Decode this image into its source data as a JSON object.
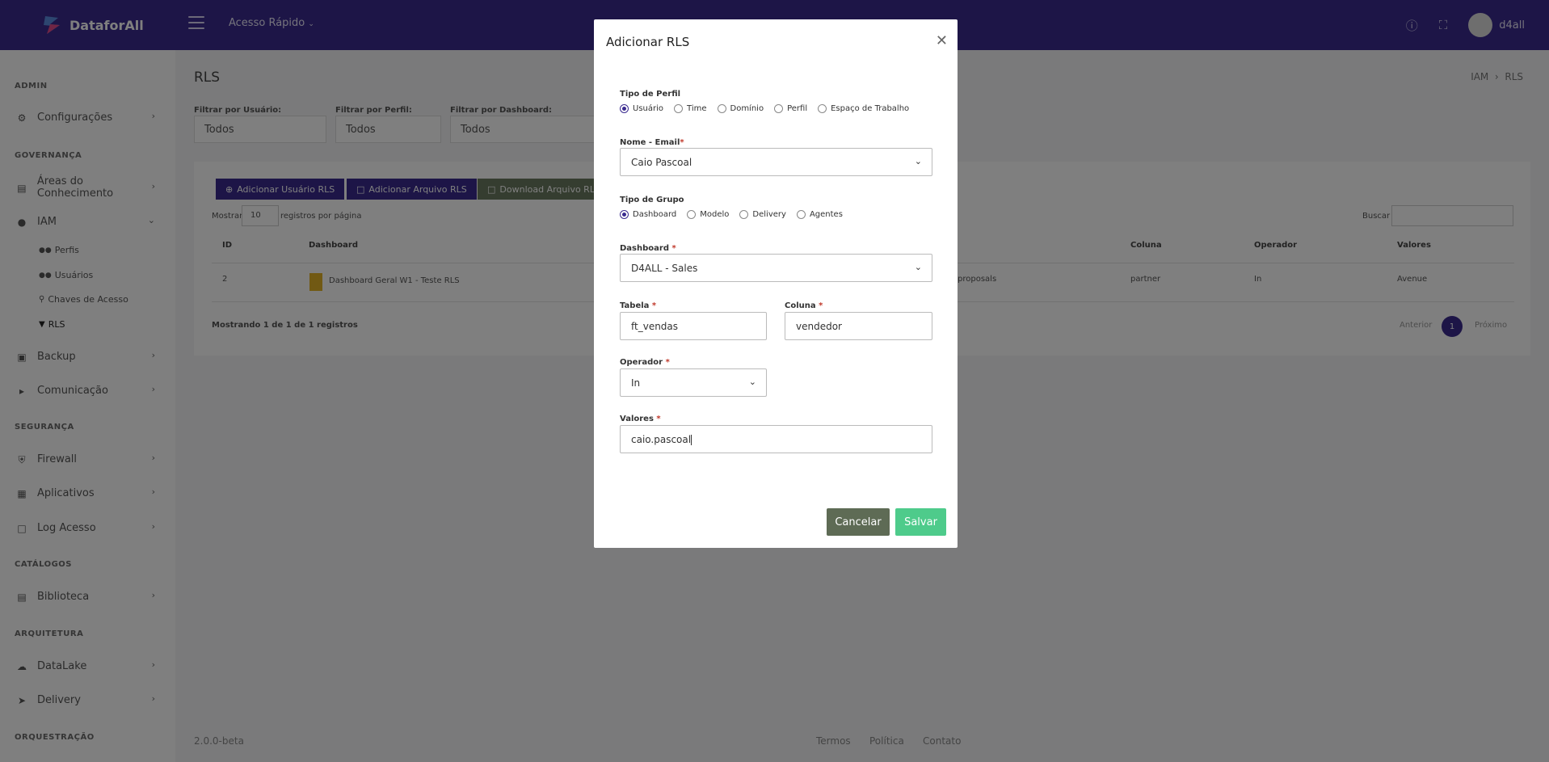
{
  "topbar": {
    "brand": "DataforAll",
    "quick_access": "Acesso Rápido",
    "user": "d4all",
    "help_icon": "question-circle-icon",
    "fullscreen_icon": "expand-icon"
  },
  "sidebar": {
    "sections": {
      "admin": "ADMIN",
      "governanca": "GOVERNANÇA",
      "seguranca": "SEGURANÇA",
      "catalogos": "CATÁLOGOS",
      "arquitetura": "ARQUITETURA",
      "orquestracao": "ORQUESTRAÇÃO"
    },
    "items": {
      "configuracoes": "Configurações",
      "areas": "Áreas do Conhecimento",
      "iam": "IAM",
      "perfis": "Perfis",
      "usuarios": "Usuários",
      "chaves": "Chaves de Acesso",
      "rls": "RLS",
      "backup": "Backup",
      "comunicacao": "Comunicação",
      "firewall": "Firewall",
      "aplicativos": "Aplicativos",
      "log": "Log Acesso",
      "biblioteca": "Biblioteca",
      "datalake": "DataLake",
      "delivery": "Delivery"
    }
  },
  "page": {
    "title": "RLS",
    "breadcrumb": [
      "IAM",
      "RLS"
    ],
    "filters": [
      {
        "label": "Filtrar por Usuário:",
        "value": "Todos"
      },
      {
        "label": "Filtrar por Perfil:",
        "value": "Todos"
      },
      {
        "label": "Filtrar por Dashboard:",
        "value": "Todos"
      }
    ],
    "buttons": {
      "add_user": "Adicionar Usuário RLS",
      "add_file": "Adicionar Arquivo RLS",
      "download": "Download Arquivo RLS"
    },
    "show": "Mostrar",
    "page_size": "10",
    "per_page": "registros por página",
    "search": "Buscar",
    "columns": {
      "id": "ID",
      "dashboard": "Dashboard",
      "coluna": "Coluna",
      "operador": "Operador",
      "valores": "Valores"
    },
    "row": {
      "id": "2",
      "dashboard": "Dashboard Geral W1 - Teste RLS",
      "tabela_partial": "proposals",
      "coluna": "partner",
      "operador": "In",
      "valores": "Avenue"
    },
    "showing": "Mostrando 1 de 1 de 1 registros",
    "pagination": {
      "prev": "Anterior",
      "page": "1",
      "next": "Próximo"
    }
  },
  "footer": {
    "version": "2.0.0-beta",
    "terms": "Termos",
    "policy": "Política",
    "contact": "Contato"
  },
  "modal": {
    "title": "Adicionar RLS",
    "tipo_perfil_label": "Tipo de Perfil",
    "tipo_perfil_options": [
      "Usuário",
      "Time",
      "Domínio",
      "Perfil",
      "Espaço de Trabalho"
    ],
    "tipo_perfil_selected": "Usuário",
    "nome_label": "Nome - Email",
    "nome_value": "Caio Pascoal",
    "tipo_grupo_label": "Tipo de Grupo",
    "tipo_grupo_options": [
      "Dashboard",
      "Modelo",
      "Delivery",
      "Agentes"
    ],
    "tipo_grupo_selected": "Dashboard",
    "dashboard_label": "Dashboard",
    "dashboard_value": "D4ALL - Sales",
    "tabela_label": "Tabela",
    "tabela_value": "ft_vendas",
    "coluna_label": "Coluna",
    "coluna_value": "vendedor",
    "operador_label": "Operador",
    "operador_value": "In",
    "valores_label": "Valores",
    "valores_value": "caio.pascoal",
    "cancel": "Cancelar",
    "save": "Salvar"
  }
}
